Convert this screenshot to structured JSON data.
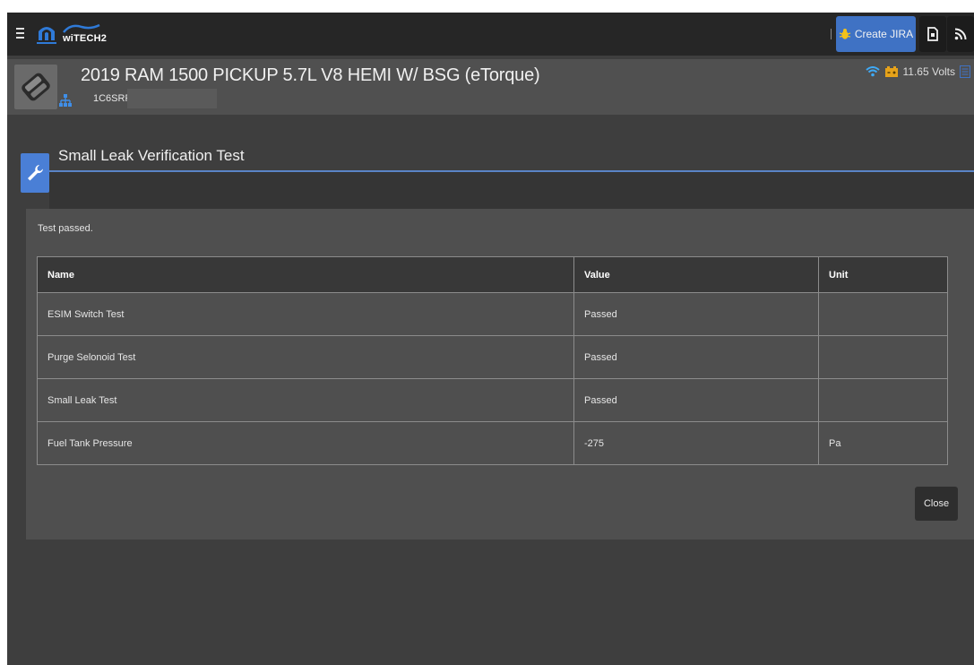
{
  "app": {
    "brand": "wiTECH2"
  },
  "toolbar": {
    "jira_label": "Create JIRA",
    "icons": [
      "menu-icon",
      "bug-icon",
      "document-icon",
      "rss-icon"
    ]
  },
  "vehicle": {
    "title": "2019 RAM 1500 PICKUP 5.7L V8 HEMI W/ BSG (eTorque)",
    "vin": "1C6SRFJT",
    "voltage": "11.65 Volts"
  },
  "dialog": {
    "title": "Small Leak Verification Test",
    "status_message": "Test passed.",
    "close_label": "Close"
  },
  "table": {
    "headers": [
      "Name",
      "Value",
      "Unit"
    ],
    "rows": [
      [
        "ESIM Switch Test",
        "Passed",
        ""
      ],
      [
        "Purge Selonoid Test",
        "Passed",
        ""
      ],
      [
        "Small Leak Test",
        "Passed",
        ""
      ],
      [
        "Fuel Tank Pressure",
        "-275",
        "Pa"
      ]
    ]
  },
  "colors": {
    "accent": "#3f72c4",
    "topbar": "#262626",
    "background": "#3e3e3e",
    "wifi": "#3fa9f5",
    "battery": "#e6a21a"
  }
}
